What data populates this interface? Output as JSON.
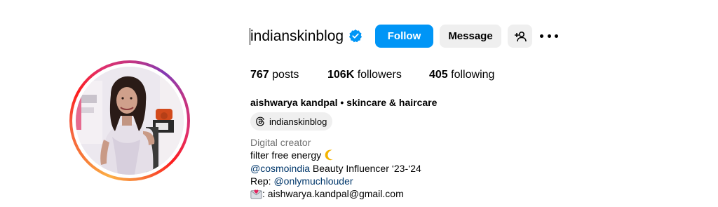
{
  "profile": {
    "username": "indianskinblog",
    "verified": true,
    "avatar": {
      "description_icon": "profile-photo",
      "ring_colors": [
        "#fcaf45",
        "#e1306c",
        "#833ab4"
      ]
    }
  },
  "actions": {
    "follow_label": "Follow",
    "message_label": "Message",
    "suggest_icon": "person-add-icon",
    "more_icon": "more-options-icon"
  },
  "stats": {
    "posts_count": "767",
    "posts_label": "posts",
    "followers_count": "106K",
    "followers_label": "followers",
    "following_count": "405",
    "following_label": "following"
  },
  "bio": {
    "full_name": "aishwarya kandpal • skincare & haircare",
    "threads_handle": "indianskinblog",
    "category": "Digital creator",
    "line1_text": "filter free energy",
    "line1_emoji": "crescent-moon-icon",
    "line2_mention": "@cosmoindia",
    "line2_text": " Beauty Influencer ‘23-‘24",
    "line3_prefix": "Rep: ",
    "line3_mention": "@onlymuchlouder",
    "line4_emoji": "envelope-heart-icon",
    "line4_text": ": aishwarya.kandpal@gmail.com"
  },
  "colors": {
    "primary_button": "#0095f6",
    "secondary_button": "#efefef",
    "mention_link": "#00376b",
    "category_text": "#737373",
    "verified_badge": "#0095f6"
  }
}
